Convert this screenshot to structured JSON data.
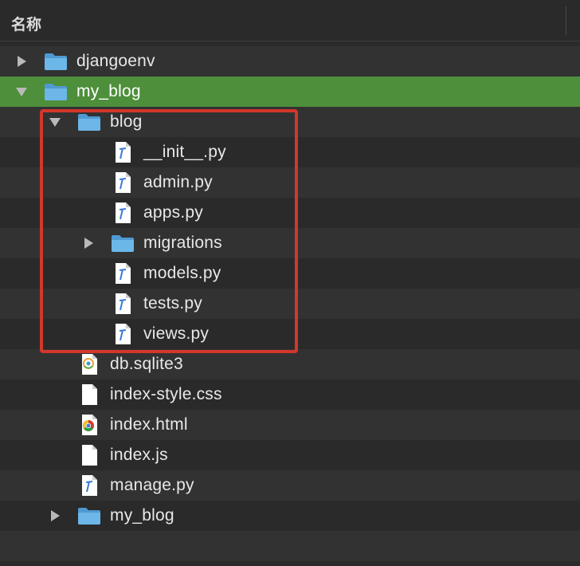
{
  "header": {
    "label": "名称"
  },
  "rows": [
    {
      "label": "djangoenv",
      "icon": "folder-icon",
      "expander": "collapsed",
      "depth": 0,
      "selected": false
    },
    {
      "label": "my_blog",
      "icon": "folder-icon",
      "expander": "expanded",
      "depth": 0,
      "selected": true
    },
    {
      "label": "blog",
      "icon": "folder-icon",
      "expander": "expanded",
      "depth": 1,
      "selected": false
    },
    {
      "label": "__init__.py",
      "icon": "python-file-icon",
      "expander": "none",
      "depth": 2,
      "selected": false
    },
    {
      "label": "admin.py",
      "icon": "python-file-icon",
      "expander": "none",
      "depth": 2,
      "selected": false
    },
    {
      "label": "apps.py",
      "icon": "python-file-icon",
      "expander": "none",
      "depth": 2,
      "selected": false
    },
    {
      "label": "migrations",
      "icon": "folder-icon",
      "expander": "collapsed",
      "depth": 2,
      "selected": false
    },
    {
      "label": "models.py",
      "icon": "python-file-icon",
      "expander": "none",
      "depth": 2,
      "selected": false
    },
    {
      "label": "tests.py",
      "icon": "python-file-icon",
      "expander": "none",
      "depth": 2,
      "selected": false
    },
    {
      "label": "views.py",
      "icon": "python-file-icon",
      "expander": "none",
      "depth": 2,
      "selected": false
    },
    {
      "label": "db.sqlite3",
      "icon": "sqlite-file-icon",
      "expander": "none",
      "depth": 1,
      "selected": false
    },
    {
      "label": "index-style.css",
      "icon": "blank-file-icon",
      "expander": "none",
      "depth": 1,
      "selected": false
    },
    {
      "label": "index.html",
      "icon": "chrome-html-icon",
      "expander": "none",
      "depth": 1,
      "selected": false
    },
    {
      "label": "index.js",
      "icon": "blank-file-icon",
      "expander": "none",
      "depth": 1,
      "selected": false
    },
    {
      "label": "manage.py",
      "icon": "python-file-icon",
      "expander": "none",
      "depth": 1,
      "selected": false
    },
    {
      "label": "my_blog",
      "icon": "folder-icon",
      "expander": "collapsed",
      "depth": 1,
      "selected": false
    },
    {
      "label": "",
      "icon": "",
      "expander": "none",
      "depth": 0,
      "selected": false
    }
  ],
  "colors": {
    "selection": "#4e8f3b",
    "highlight_border": "#d3372b",
    "folder": "#5aa7df"
  }
}
